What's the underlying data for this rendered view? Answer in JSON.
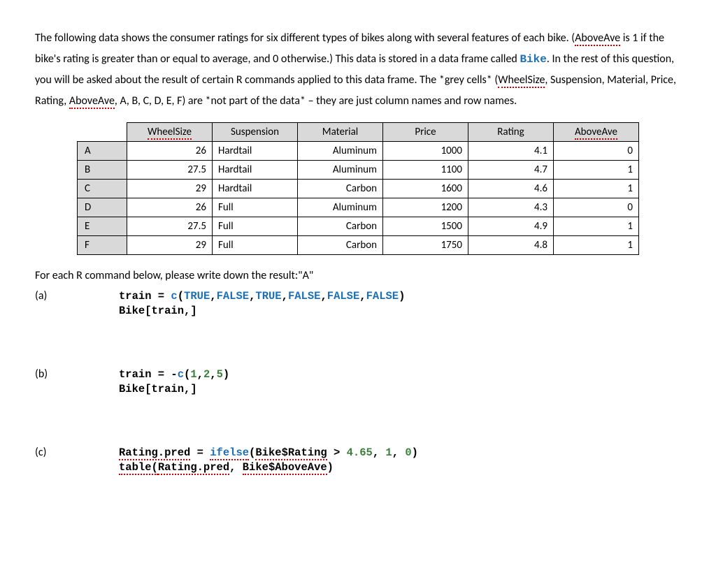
{
  "intro": {
    "p1_a": "The following data shows the consumer ratings for six different types of bikes along with several features of each bike. (",
    "p1_aboveave1": "AboveAve",
    "p1_b": " is 1 if the bike's rating is greater than or equal to average, and 0 otherwise.) This data is stored in a data frame called ",
    "p1_bike": "Bike",
    "p1_c": ". In the rest of this question, you will be asked about the result of certain R commands applied to this data frame. The *grey cells* (",
    "p1_wheel": "WheelSize",
    "p1_d": ", Suspension, Material, Price, Rating, ",
    "p1_aboveave2": "AboveAve",
    "p1_e": ", A, B, C, D, E, F) are *not part of the data* – they are just column names and row names."
  },
  "table": {
    "headers": {
      "c1": "WheelSize",
      "c2": "Suspension",
      "c3": "Material",
      "c4": "Price",
      "c5": "Rating",
      "c6": "AboveAve"
    },
    "rows": [
      {
        "rh": "A",
        "c1": "26",
        "c2": "Hardtail",
        "c3": "Aluminum",
        "c4": "1000",
        "c5": "4.1",
        "c6": "0"
      },
      {
        "rh": "B",
        "c1": "27.5",
        "c2": "Hardtail",
        "c3": "Aluminum",
        "c4": "1100",
        "c5": "4.7",
        "c6": "1"
      },
      {
        "rh": "C",
        "c1": "29",
        "c2": "Hardtail",
        "c3": "Carbon",
        "c4": "1600",
        "c5": "4.6",
        "c6": "1"
      },
      {
        "rh": "D",
        "c1": "26",
        "c2": "Full",
        "c3": "Aluminum",
        "c4": "1200",
        "c5": "4.3",
        "c6": "0"
      },
      {
        "rh": "E",
        "c1": "27.5",
        "c2": "Full",
        "c3": "Carbon",
        "c4": "1500",
        "c5": "4.9",
        "c6": "1"
      },
      {
        "rh": "F",
        "c1": "29",
        "c2": "Full",
        "c3": "Carbon",
        "c4": "1750",
        "c5": "4.8",
        "c6": "1"
      }
    ]
  },
  "prompt": "For each R command below, please write down the result:\"A\"",
  "qa": {
    "a": {
      "label": "(a)",
      "l1a": "train = ",
      "l1b": "c",
      "l1c": "(",
      "l1d": "TRUE",
      "l1e": ",",
      "l1f": "FALSE",
      "l1g": ",",
      "l1h": "TRUE",
      "l1i": ",",
      "l1j": "FALSE",
      "l1k": ",",
      "l1l": "FALSE",
      "l1m": ",",
      "l1n": "FALSE",
      "l1o": ")",
      "l2": "Bike[train,]"
    },
    "b": {
      "label": "(b)",
      "l1a": "train = -",
      "l1b": "c",
      "l1c": "(",
      "l1d": "1",
      "l1e": ",",
      "l1f": "2",
      "l1g": ",",
      "l1h": "5",
      "l1i": ")",
      "l2": "Bike[train,]"
    },
    "c": {
      "label": "(c)",
      "l1a": "Rating.pred",
      "l1b": " = ",
      "l1c": "ifelse",
      "l1d": "(",
      "l1e": "Bike$Rating",
      "l1f": " > ",
      "l1g": "4.65",
      "l1h": ", ",
      "l1i": "1",
      "l1j": ", ",
      "l1k": "0",
      "l1l": ")",
      "l2a": "table(",
      "l2b": "Rating.pred",
      "l2c": ", ",
      "l2d": "Bike$AboveAve",
      "l2e": ")"
    }
  },
  "chart_data": {
    "type": "table",
    "columns": [
      "WheelSize",
      "Suspension",
      "Material",
      "Price",
      "Rating",
      "AboveAve"
    ],
    "rows": [
      {
        "row": "A",
        "WheelSize": 26,
        "Suspension": "Hardtail",
        "Material": "Aluminum",
        "Price": 1000,
        "Rating": 4.1,
        "AboveAve": 0
      },
      {
        "row": "B",
        "WheelSize": 27.5,
        "Suspension": "Hardtail",
        "Material": "Aluminum",
        "Price": 1100,
        "Rating": 4.7,
        "AboveAve": 1
      },
      {
        "row": "C",
        "WheelSize": 29,
        "Suspension": "Hardtail",
        "Material": "Carbon",
        "Price": 1600,
        "Rating": 4.6,
        "AboveAve": 1
      },
      {
        "row": "D",
        "WheelSize": 26,
        "Suspension": "Full",
        "Material": "Aluminum",
        "Price": 1200,
        "Rating": 4.3,
        "AboveAve": 0
      },
      {
        "row": "E",
        "WheelSize": 27.5,
        "Suspension": "Full",
        "Material": "Carbon",
        "Price": 1500,
        "Rating": 4.9,
        "AboveAve": 1
      },
      {
        "row": "F",
        "WheelSize": 29,
        "Suspension": "Full",
        "Material": "Carbon",
        "Price": 1750,
        "Rating": 4.8,
        "AboveAve": 1
      }
    ]
  }
}
